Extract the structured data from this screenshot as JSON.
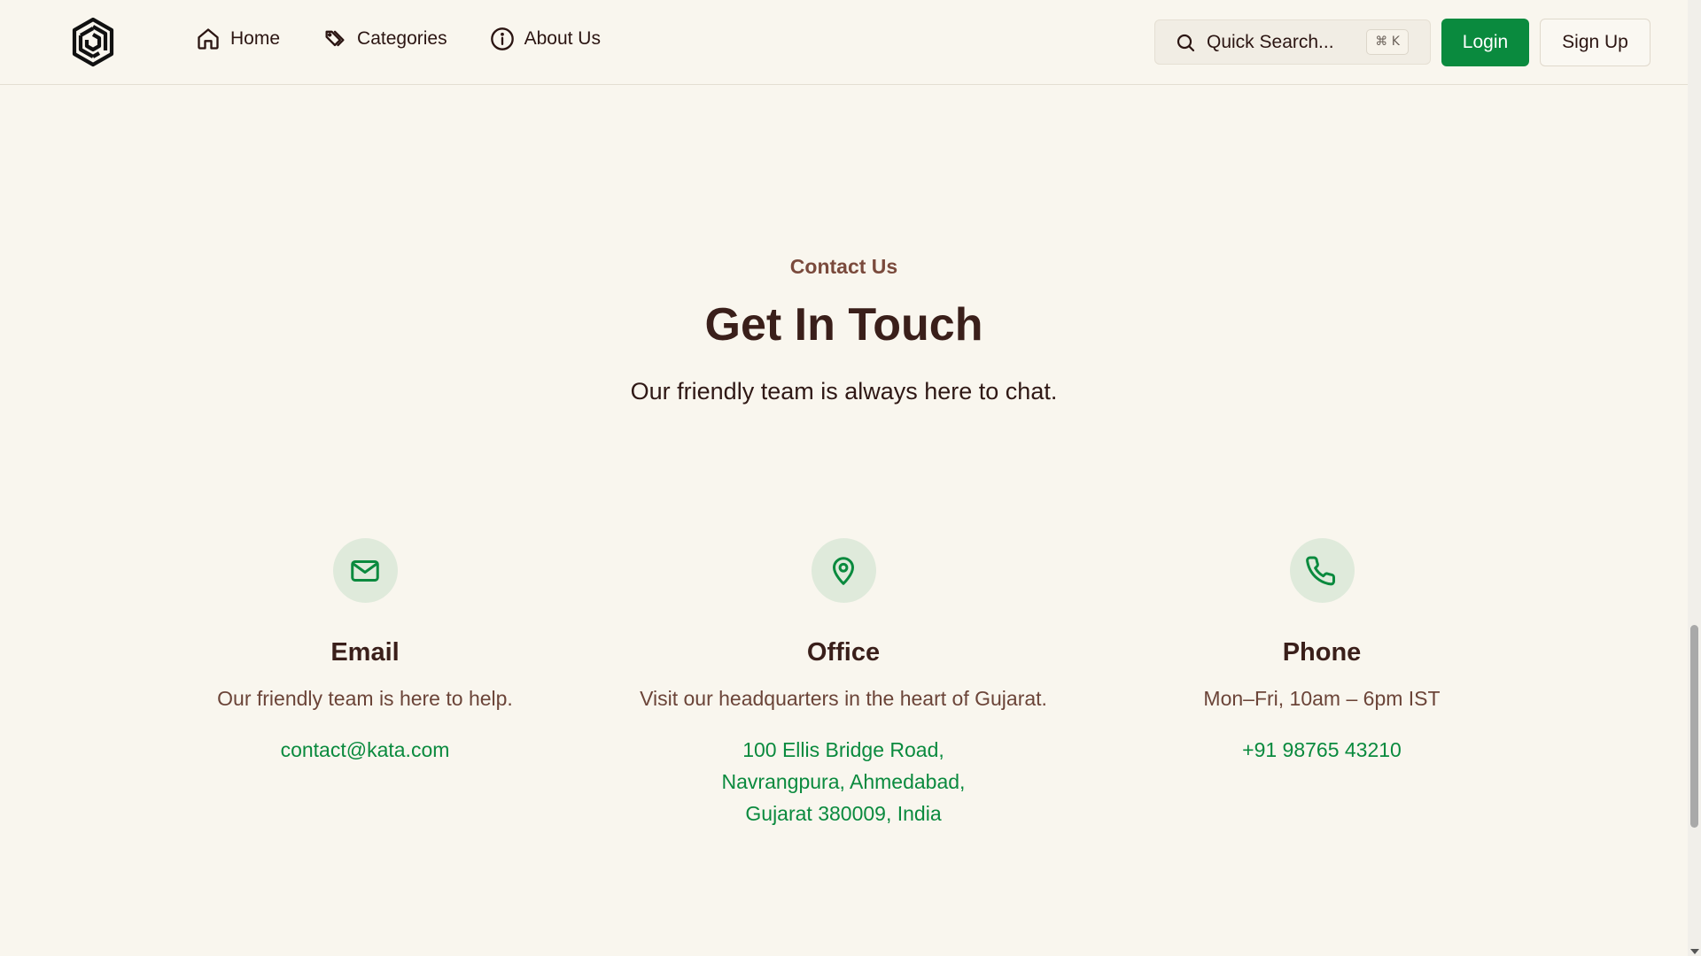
{
  "nav": {
    "items": [
      {
        "label": "Home",
        "icon": "home-icon"
      },
      {
        "label": "Categories",
        "icon": "tag-icon"
      },
      {
        "label": "About Us",
        "icon": "info-icon"
      }
    ]
  },
  "search": {
    "placeholder": "Quick Search...",
    "shortcut": "⌘ K"
  },
  "auth": {
    "login_label": "Login",
    "signup_label": "Sign Up"
  },
  "hero": {
    "eyebrow": "Contact Us",
    "title": "Get In Touch",
    "subtitle": "Our friendly team is always here to chat."
  },
  "contact_cards": [
    {
      "icon": "mail-icon",
      "title": "Email",
      "description": "Our friendly team is here to help.",
      "link_lines": [
        "contact@kata.com"
      ]
    },
    {
      "icon": "map-pin-icon",
      "title": "Office",
      "description": "Visit our headquarters in the heart of Gujarat.",
      "link_lines": [
        "100 Ellis Bridge Road,",
        "Navrangpura, Ahmedabad,",
        "Gujarat 380009, India"
      ]
    },
    {
      "icon": "phone-icon",
      "title": "Phone",
      "description": "Mon–Fri, 10am – 6pm IST",
      "link_lines": [
        "+91 98765 43210"
      ]
    }
  ],
  "colors": {
    "background": "#f9f6ee",
    "accent": "#0a8a3e",
    "heading": "#3a1f1a",
    "eyebrow": "#7a4a3c",
    "icon_circle": "#dfeadb"
  }
}
